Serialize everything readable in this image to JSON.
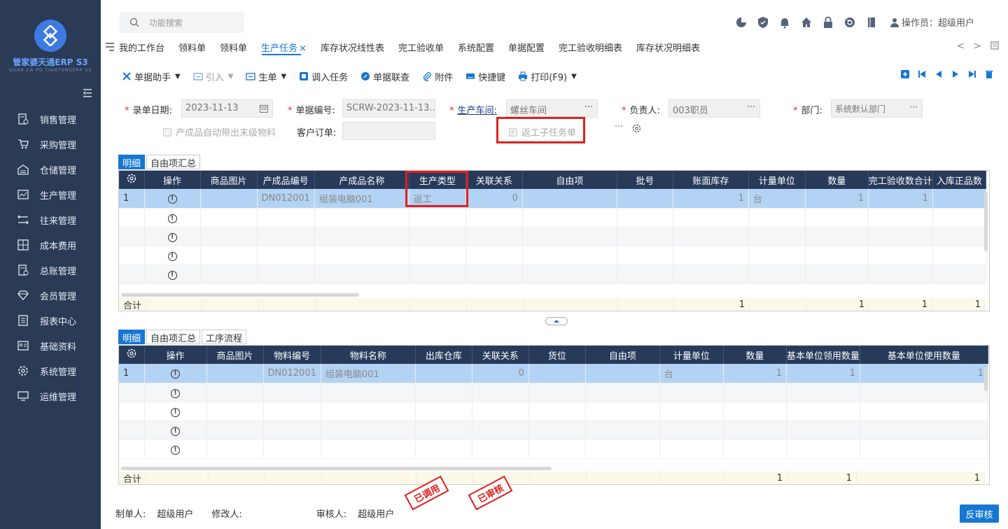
{
  "app": {
    "name": "管家婆天通ERP S3",
    "name_sub": "GUAN JIA PO TIANTONGERP S3"
  },
  "sidebar": {
    "items": [
      {
        "label": "销售管理",
        "icon": "sales-icon"
      },
      {
        "label": "采购管理",
        "icon": "cart-icon"
      },
      {
        "label": "仓储管理",
        "icon": "warehouse-icon"
      },
      {
        "label": "生产管理",
        "icon": "production-icon"
      },
      {
        "label": "往来管理",
        "icon": "exchange-icon"
      },
      {
        "label": "成本费用",
        "icon": "calculator-icon"
      },
      {
        "label": "总账管理",
        "icon": "ledger-icon"
      },
      {
        "label": "会员管理",
        "icon": "diamond-icon"
      },
      {
        "label": "报表中心",
        "icon": "report-icon"
      },
      {
        "label": "基础资料",
        "icon": "id-card-icon"
      },
      {
        "label": "系统管理",
        "icon": "gear-icon"
      },
      {
        "label": "运维管理",
        "icon": "monitor-icon"
      }
    ]
  },
  "header": {
    "search_placeholder": "功能搜索",
    "operator": "操作员：超级用户"
  },
  "tabs": [
    {
      "label": "我的工作台"
    },
    {
      "label": "领料单"
    },
    {
      "label": "领料单"
    },
    {
      "label": "生产任务"
    },
    {
      "label": "库存状况线性表"
    },
    {
      "label": "完工验收单"
    },
    {
      "label": "系统配置"
    },
    {
      "label": "单据配置"
    },
    {
      "label": "完工验收明细表"
    },
    {
      "label": "库存状况明细表"
    }
  ],
  "tab_close": "×",
  "toolbar": {
    "assistant": "单据助手",
    "import": "引入",
    "generate": "生单",
    "transfer_task": "调入任务",
    "linked_query": "单据联查",
    "attachment": "附件",
    "shortcut": "快捷键",
    "print": "打印(F9)"
  },
  "form": {
    "date_label": "录单日期:",
    "date_value": "2023-11-13",
    "number_label": "单据编号:",
    "number_value": "SCRW-2023-11-13...",
    "workshop_label": "生产车间:",
    "workshop_value": "螺丝车间",
    "owner_label": "负责人:",
    "owner_value": "003职员",
    "dept_label": "部门:",
    "dept_value": "系统默认部门",
    "auto_bring_label": "产成品自动带出末级物料",
    "customer_order_label": "客户订单:",
    "customer_order_value": "",
    "rework_label": "返工子任务单",
    "more": "···"
  },
  "grid1": {
    "tabs": [
      "明细",
      "自由项汇总"
    ],
    "headers": [
      "操作",
      "商品图片",
      "产成品编号",
      "产成品名称",
      "生产类型",
      "关联关系",
      "自由项",
      "批号",
      "账面库存",
      "计量单位",
      "数量",
      "完工验收数合计",
      "入库正品数"
    ],
    "rows": [
      [
        "1",
        "",
        "",
        "DN012001",
        "组装电脑001",
        "返工",
        "0",
        "",
        "",
        "1",
        "台",
        "1",
        "1",
        ""
      ]
    ],
    "sum_label": "合计",
    "sum_values": [
      "1",
      "1",
      "1",
      "1"
    ]
  },
  "grid2": {
    "tabs": [
      "明细",
      "自由项汇总",
      "工序流程"
    ],
    "headers": [
      "操作",
      "商品图片",
      "物料编号",
      "物料名称",
      "出库仓库",
      "关联关系",
      "货位",
      "自由项",
      "计量单位",
      "数量",
      "基本单位领用数量",
      "基本单位使用数量"
    ],
    "rows": [
      [
        "1",
        "",
        "",
        "DN012001",
        "组装电脑001",
        "",
        "0",
        "",
        "",
        "台",
        "1",
        "1",
        "1"
      ]
    ],
    "sum_label": "合计",
    "sum_values": [
      "1",
      "1",
      "1"
    ]
  },
  "stamps": {
    "called": "已调用",
    "audited": "已审核"
  },
  "footer": {
    "maker_label": "制单人:",
    "maker": "超级用户",
    "modifier_label": "修改人:",
    "modifier": "",
    "auditor_label": "审核人:",
    "auditor": "超级用户",
    "unaudit_button": "反审核"
  },
  "colors": {
    "sidebar": "#2b3a55",
    "header_grid": "#273a5a",
    "accent": "#1677d2",
    "selected_row": "#b3d3f5",
    "highlight": "#e02020"
  }
}
